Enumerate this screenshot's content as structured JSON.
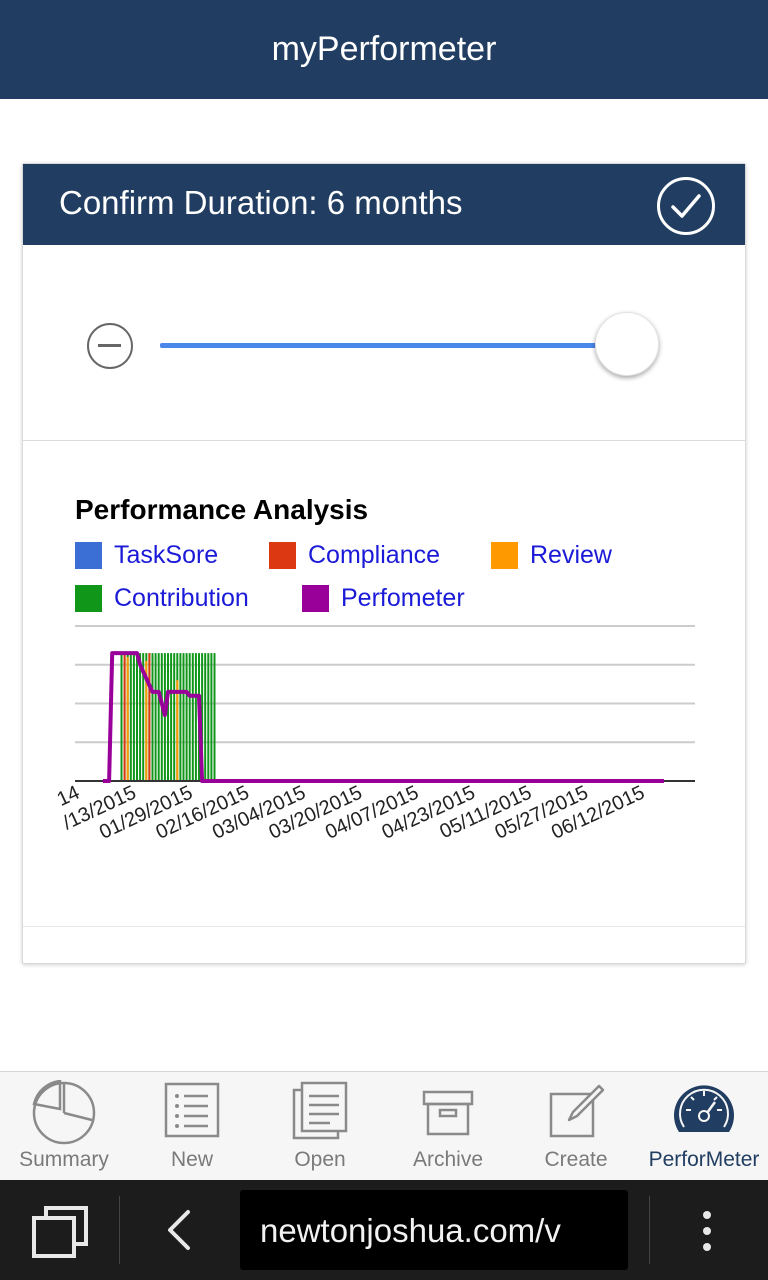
{
  "header": {
    "title": "myPerformeter"
  },
  "duration_card": {
    "title": "Confirm Duration: 6 months",
    "confirm_icon": "checkmark-circle-icon",
    "decrease_icon": "minus-circle-icon",
    "slider_value_fraction": 1.0
  },
  "chart_data": {
    "type": "bar",
    "title": "Performance Analysis",
    "legend": [
      {
        "name": "TaskSore",
        "color": "#3b6fd6"
      },
      {
        "name": "Compliance",
        "color": "#dc3912"
      },
      {
        "name": "Review",
        "color": "#ff9900"
      },
      {
        "name": "Contribution",
        "color": "#109618"
      },
      {
        "name": "Perfometer",
        "color": "#990099"
      }
    ],
    "x_tick_labels": [
      "14",
      "/13/2015",
      "01/29/2015",
      "02/16/2015",
      "03/04/2015",
      "03/20/2015",
      "04/07/2015",
      "04/23/2015",
      "05/11/2015",
      "05/27/2015",
      "06/12/2015"
    ],
    "ylim": [
      0,
      4
    ],
    "grid": true,
    "legend_position": "top",
    "series": [
      {
        "name": "Contribution",
        "type": "bar",
        "color": "#109618",
        "x": [
          "01/04/2015",
          "01/05/2015",
          "01/06/2015",
          "01/07/2015",
          "01/08/2015",
          "01/09/2015",
          "01/10/2015",
          "01/11/2015",
          "01/12/2015",
          "01/13/2015",
          "01/14/2015",
          "01/15/2015",
          "01/16/2015",
          "01/17/2015",
          "01/18/2015",
          "01/19/2015",
          "01/20/2015",
          "01/21/2015",
          "01/22/2015",
          "01/23/2015",
          "01/24/2015",
          "01/25/2015",
          "01/26/2015",
          "01/27/2015",
          "01/28/2015",
          "01/29/2015",
          "01/30/2015",
          "01/31/2015",
          "02/01/2015",
          "02/02/2015",
          "02/03/2015"
        ],
        "values": [
          3.3,
          3.3,
          3.3,
          3.3,
          3.3,
          3.3,
          3.3,
          3.3,
          3.3,
          3.3,
          3.3,
          3.3,
          3.3,
          3.3,
          3.3,
          3.3,
          3.3,
          3.3,
          3.3,
          3.3,
          3.3,
          3.3,
          3.3,
          3.3,
          3.3,
          3.3,
          3.3,
          3.3,
          3.3,
          3.3,
          3.3
        ]
      },
      {
        "name": "Review",
        "type": "bar",
        "color": "#ff9900",
        "x": [
          "01/06/2015",
          "01/12/2015",
          "01/22/2015"
        ],
        "values": [
          3.2,
          3.1,
          2.6
        ]
      },
      {
        "name": "Compliance",
        "type": "bar",
        "color": "#dc3912",
        "x": [
          "01/05/2015",
          "01/13/2015"
        ],
        "values": [
          3.3,
          3.3
        ]
      },
      {
        "name": "Perfometer",
        "type": "line",
        "color": "#990099",
        "x": [
          "12/29/2014",
          "12/31/2014",
          "01/01/2015",
          "01/09/2015",
          "01/10/2015",
          "01/14/2015",
          "01/16/2015",
          "01/18/2015",
          "01/19/2015",
          "01/22/2015",
          "01/25/2015",
          "01/26/2015",
          "01/29/2015",
          "01/30/2015",
          "06/28/2015"
        ],
        "values": [
          0,
          0,
          3.3,
          3.3,
          3.0,
          2.3,
          2.3,
          1.7,
          2.3,
          2.3,
          2.3,
          2.2,
          2.2,
          0,
          0
        ]
      }
    ]
  },
  "tabbar": {
    "tabs": [
      {
        "label": "Summary",
        "icon": "pie-chart-icon",
        "active": false
      },
      {
        "label": "New",
        "icon": "list-icon",
        "active": false
      },
      {
        "label": "Open",
        "icon": "document-icon",
        "active": false
      },
      {
        "label": "Archive",
        "icon": "archive-box-icon",
        "active": false
      },
      {
        "label": "Create",
        "icon": "edit-icon",
        "active": false
      },
      {
        "label": "PerforMeter",
        "icon": "speedometer-icon",
        "active": true
      }
    ]
  },
  "browser_bar": {
    "url": "newtonjoshua.com/v",
    "tabs_icon": "tabs-icon",
    "back_icon": "back-arrow-icon",
    "menu_icon": "overflow-menu-icon"
  }
}
